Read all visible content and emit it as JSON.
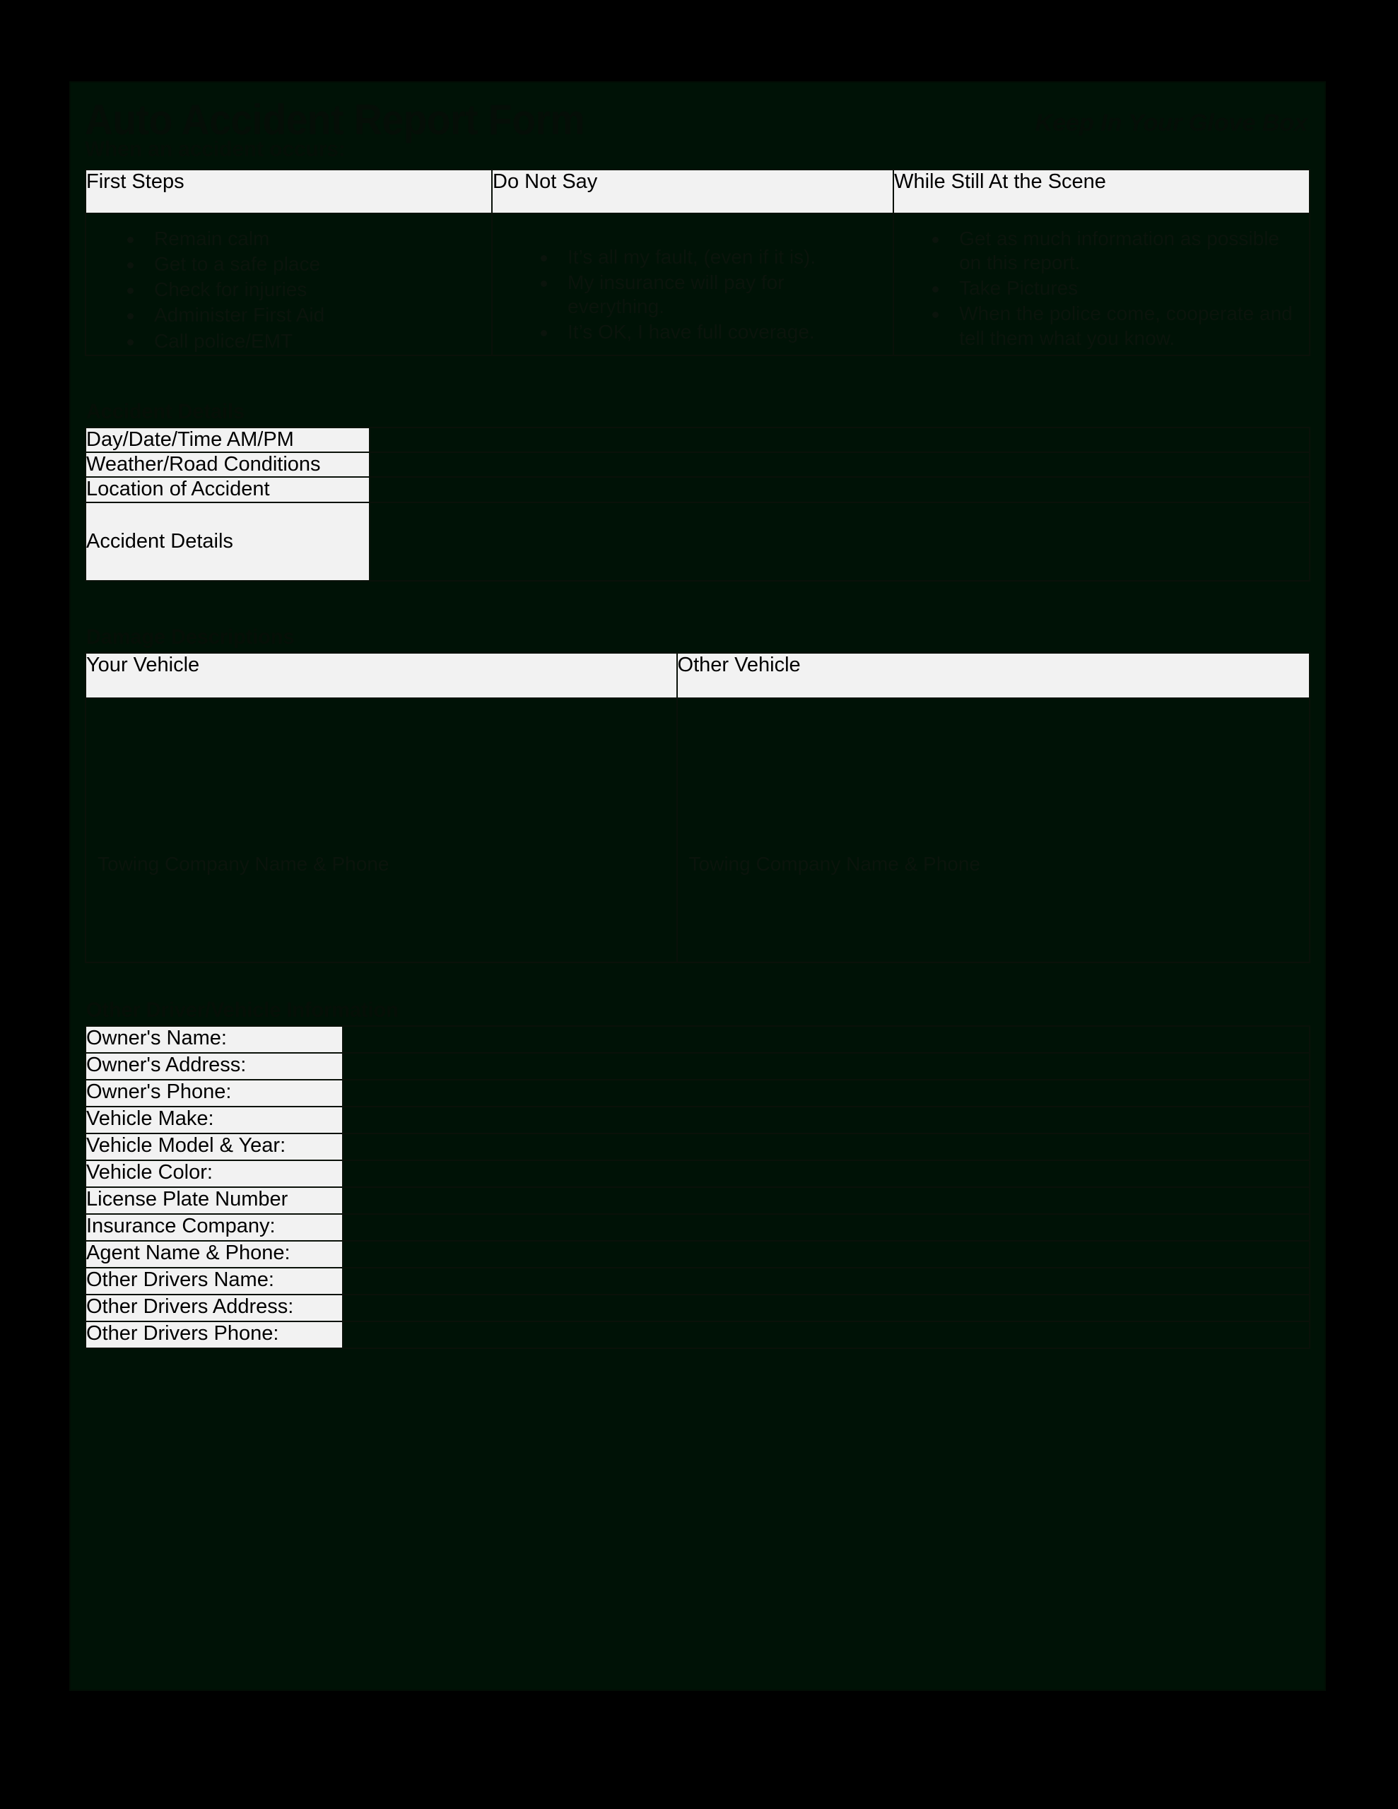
{
  "document": {
    "title": "Auto Accident Report Form",
    "tagline": "Keep In Your Glove Box",
    "subtitle": "When an accident occurs:"
  },
  "advice_table": {
    "columns": [
      {
        "header": "First Steps",
        "bullets": [
          "Remain calm",
          "Get to a safe place",
          "Check for injuries",
          "Administer First Aid",
          "Call police/EMT"
        ]
      },
      {
        "header": "Do Not Say",
        "bullets": [
          "It’s all my fault, (even if it is).",
          "My insurance will pay for everything.",
          "It’s OK, I have full coverage."
        ]
      },
      {
        "header": "While Still At the Scene",
        "bullets": [
          "Get as much information as possible on this report.",
          "Take Pictures",
          "When the police come, cooperate and tell them what you know."
        ]
      }
    ]
  },
  "accident_details": {
    "heading": "Accident Details",
    "rows": [
      {
        "label": "Day/Date/Time AM/PM",
        "value": ""
      },
      {
        "label": "Weather/Road Conditions",
        "value": ""
      },
      {
        "label": "Location of Accident",
        "value": ""
      },
      {
        "label": "Accident Details",
        "value": ""
      }
    ]
  },
  "damage_descriptions": {
    "heading": "Damage Descriptions",
    "columns": [
      {
        "header": "Your Vehicle",
        "towing_label": "Towing Company Name & Phone",
        "value": ""
      },
      {
        "header": "Other Vehicle",
        "towing_label": "Towing Company Name & Phone",
        "value": ""
      }
    ]
  },
  "other_driver": {
    "heading": "Other Driver/Vehicle Information",
    "rows": [
      {
        "label": "Owner's Name:",
        "value": ""
      },
      {
        "label": "Owner's Address:",
        "value": ""
      },
      {
        "label": "Owner's Phone:",
        "value": ""
      },
      {
        "label": "Vehicle Make:",
        "value": ""
      },
      {
        "label": "Vehicle Model & Year:",
        "value": ""
      },
      {
        "label": "Vehicle Color:",
        "value": ""
      },
      {
        "label": "License Plate Number",
        "value": ""
      },
      {
        "label": "Insurance Company:",
        "value": ""
      },
      {
        "label": "Agent Name & Phone:",
        "value": ""
      },
      {
        "label": "Other Drivers Name:",
        "value": ""
      },
      {
        "label": "Other Drivers Address:",
        "value": ""
      },
      {
        "label": "Other Drivers Phone:",
        "value": ""
      }
    ]
  },
  "colors": {
    "page_background": "#001206",
    "outside_background": "#000000",
    "label_cell_background": "#f2f2f2",
    "border": "#0a1109",
    "faint_text": "#0b140c"
  }
}
